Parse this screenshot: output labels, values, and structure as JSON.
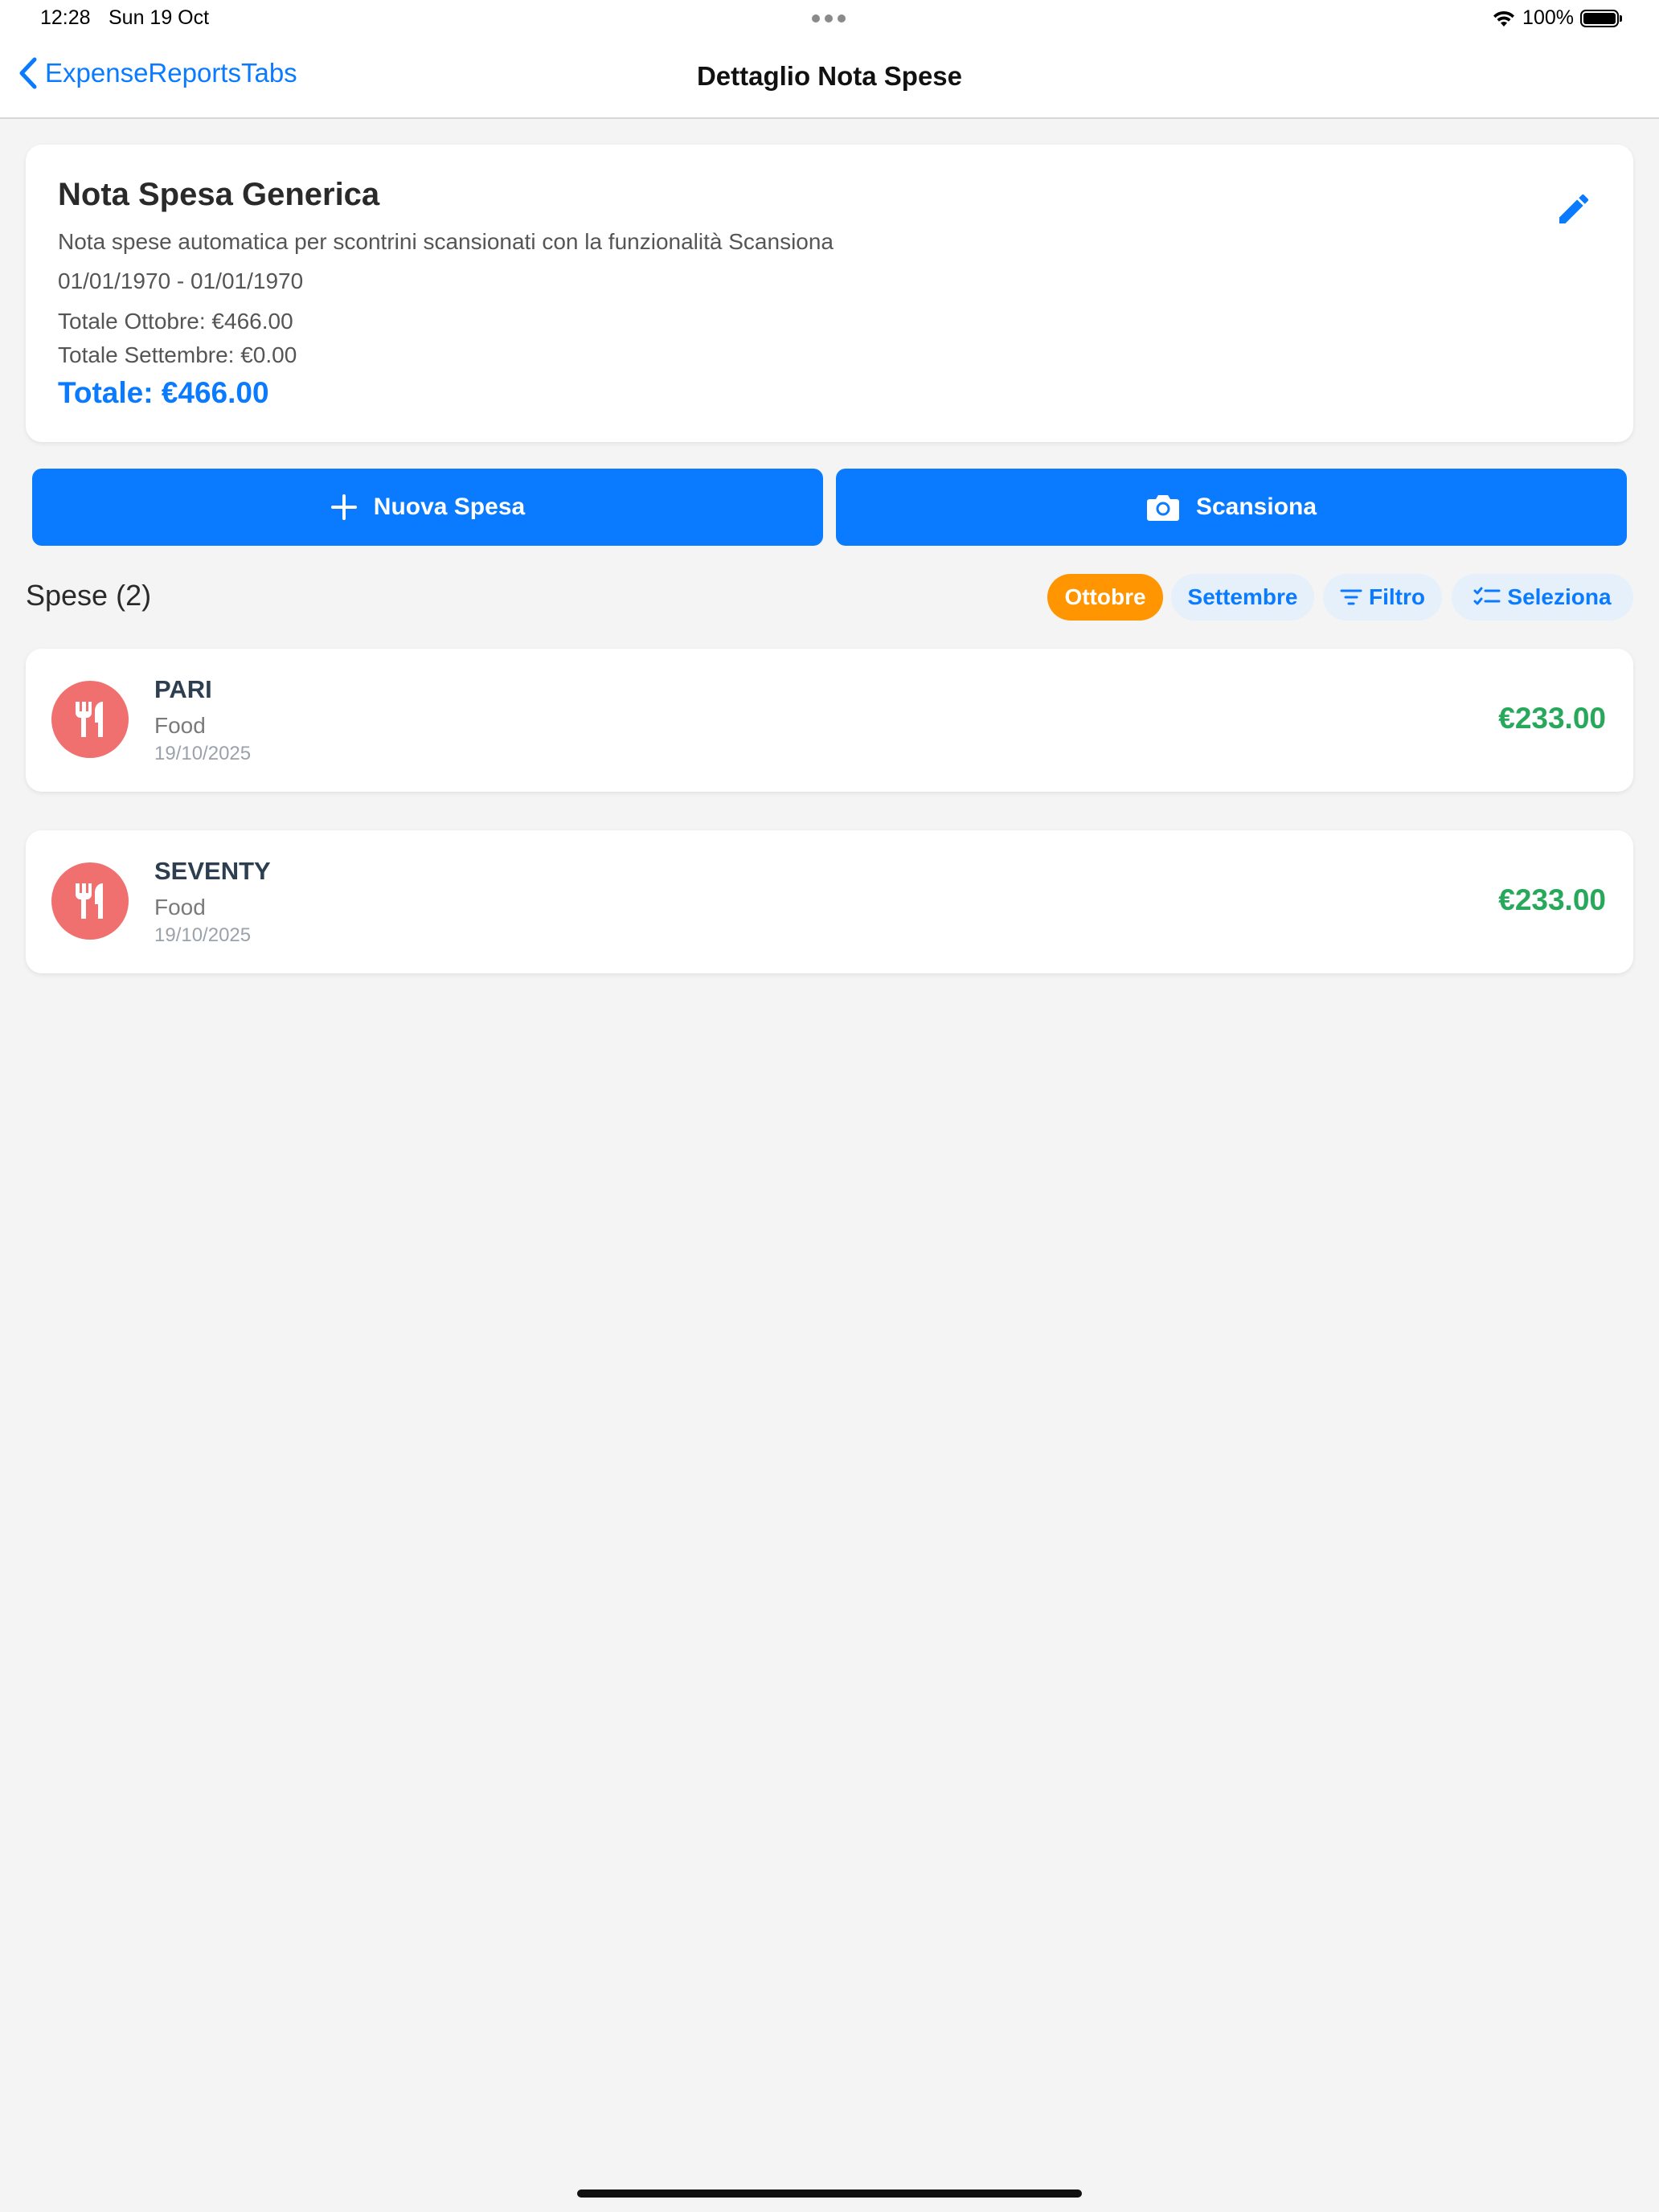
{
  "status_bar": {
    "time": "12:28",
    "date": "Sun 19 Oct",
    "battery": "100%",
    "battery_level": 1.0,
    "icons": [
      "wifi-icon",
      "battery-icon"
    ]
  },
  "nav": {
    "back_label": "ExpenseReportsTabs",
    "title": "Dettaglio Nota Spese"
  },
  "report": {
    "title": "Nota Spesa Generica",
    "description": "Nota spese automatica per scontrini scansionati con la funzionalità Scansiona",
    "date_range": "01/01/1970 - 01/01/1970",
    "total_october": "Totale Ottobre: €466.00",
    "total_september": "Totale Settembre: €0.00",
    "total": "Totale: €466.00",
    "edit_icon": "pencil-icon"
  },
  "actions": {
    "new_expense_label": "Nuova Spesa",
    "new_expense_icon": "plus-icon",
    "scan_label": "Scansiona",
    "scan_icon": "camera-icon"
  },
  "expenses_section": {
    "title": "Spese (2)",
    "filters": [
      {
        "label": "Ottobre",
        "active": true
      },
      {
        "label": "Settembre",
        "active": false
      }
    ],
    "filter_label": "Filtro",
    "select_label": "Seleziona"
  },
  "expenses": [
    {
      "name": "PARI",
      "category": "Food",
      "date": "19/10/2025",
      "amount": "€233.00",
      "icon": "fork-knife-icon"
    },
    {
      "name": "SEVENTY",
      "category": "Food",
      "date": "19/10/2025",
      "amount": "€233.00",
      "icon": "fork-knife-icon"
    }
  ],
  "colors": {
    "accent": "#0a7aff",
    "active_chip": "#ff9500",
    "amount": "#27a85b",
    "food_icon_bg": "#f07070",
    "background": "#f4f4f4"
  }
}
